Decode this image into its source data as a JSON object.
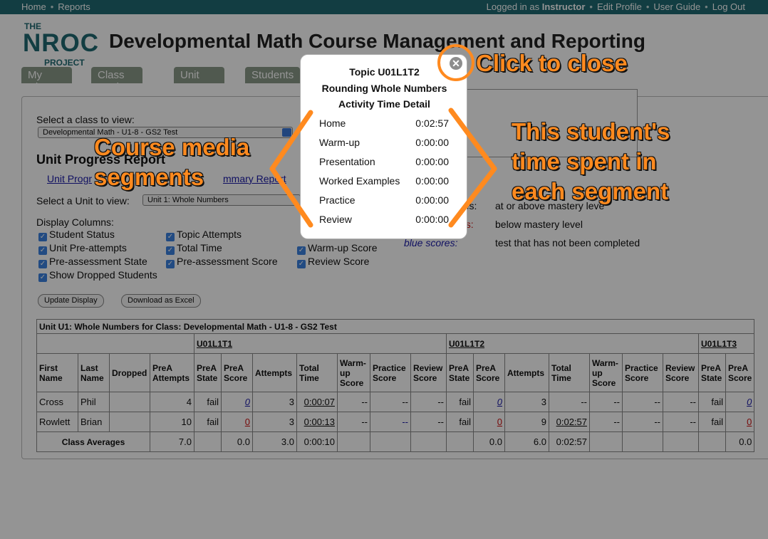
{
  "topnav": {
    "left": [
      "Home",
      "Reports"
    ],
    "logged_prefix": "Logged in as ",
    "user": "Instructor",
    "right": [
      "Edit Profile",
      "User Guide",
      "Log Out"
    ]
  },
  "logo": {
    "the": "THE",
    "nroc": "NROC",
    "project": "PROJECT"
  },
  "app_title": "Developmental Math Course Management and Reporting",
  "tabs": [
    "My Classes",
    "Class Settings",
    "Unit Content",
    "Students"
  ],
  "class_select": {
    "label": "Select a class to view:",
    "value": "Developmental Math - U1-8 - GS2 Test"
  },
  "report": {
    "title": "Unit Progress Report",
    "link1": "Unit Progr",
    "link2": "mmary Report"
  },
  "unit_select": {
    "label": "Select a Unit to view:",
    "value": "Unit 1: Whole Numbers"
  },
  "display_columns": {
    "label": "Display Columns:",
    "items": [
      "Student Status",
      "Unit Pre-attempts",
      "Pre-assessment State",
      "Show Dropped Students",
      "Topic Attempts",
      "Total Time",
      "Pre-assessment Score",
      "Warm-up Score",
      "Review Score"
    ]
  },
  "buttons": {
    "update": "Update Display",
    "download": "Download as Excel"
  },
  "legend": {
    "row1_key": "res:",
    "row1_text": "at or above mastery leve",
    "row2_key": "es:",
    "row2_text": "below mastery level",
    "row3_key": "blue scores:",
    "row3_text": "test that has not been completed"
  },
  "table": {
    "caption": "Unit U1: Whole Numbers for Class: Developmental Math - U1-8 - GS2 Test",
    "groups": [
      "U01L1T1",
      "U01L1T2",
      "U01L1T3"
    ],
    "student_headers": [
      "First Name",
      "Last Name",
      "Dropped",
      "PreA Attempts"
    ],
    "topic_headers": [
      "PreA State",
      "PreA Score",
      "Attempts",
      "Total Time",
      "Warm-up Score",
      "Practice Score",
      "Review Score"
    ],
    "t3_headers": [
      "PreA State",
      "PreA Score"
    ],
    "rows": [
      {
        "first": "Cross",
        "last": "Phil",
        "dropped": "",
        "prea": "4",
        "t1": [
          "fail",
          "0",
          "3",
          "0:00:07",
          "--",
          "--",
          "--"
        ],
        "t2": [
          "fail",
          "0",
          "3",
          "--",
          "--",
          "--",
          "--"
        ],
        "t3": [
          "fail",
          "0"
        ]
      },
      {
        "first": "Rowlett",
        "last": "Brian",
        "dropped": "",
        "prea": "10",
        "t1": [
          "fail",
          "0",
          "3",
          "0:00:13",
          "--",
          "--",
          "--"
        ],
        "t2": [
          "fail",
          "0",
          "9",
          "0:02:57",
          "--",
          "--",
          "--"
        ],
        "t3": [
          "fail",
          "0"
        ]
      }
    ],
    "averages": {
      "label": "Class Averages",
      "prea": "7.0",
      "t1": [
        "",
        "0.0",
        "3.0",
        "0:00:10",
        "",
        "",
        ""
      ],
      "t2": [
        "",
        "0.0",
        "6.0",
        "0:02:57",
        "",
        "",
        ""
      ],
      "t3": [
        "",
        "0.0"
      ]
    }
  },
  "popup": {
    "title1": "Topic U01L1T2",
    "title2": "Rounding Whole Numbers",
    "title3": "Activity Time Detail",
    "rows": [
      [
        "Home",
        "0:02:57"
      ],
      [
        "Warm-up",
        "0:00:00"
      ],
      [
        "Presentation",
        "0:00:00"
      ],
      [
        "Worked Examples",
        "0:00:00"
      ],
      [
        "Practice",
        "0:00:00"
      ],
      [
        "Review",
        "0:00:00"
      ]
    ],
    "close_icon": "close-icon"
  },
  "annotations": {
    "close": "Click to close",
    "media_1": "Course media",
    "media_2": "segments",
    "time_1": "This student's",
    "time_2": "time spent in",
    "time_3": "each segment"
  },
  "colors": {
    "teal": "#1f6a72",
    "tab": "#8a9a88",
    "accent": "#ff8a1f",
    "link": "#1a1aa8",
    "red_score": "#cc1111"
  }
}
